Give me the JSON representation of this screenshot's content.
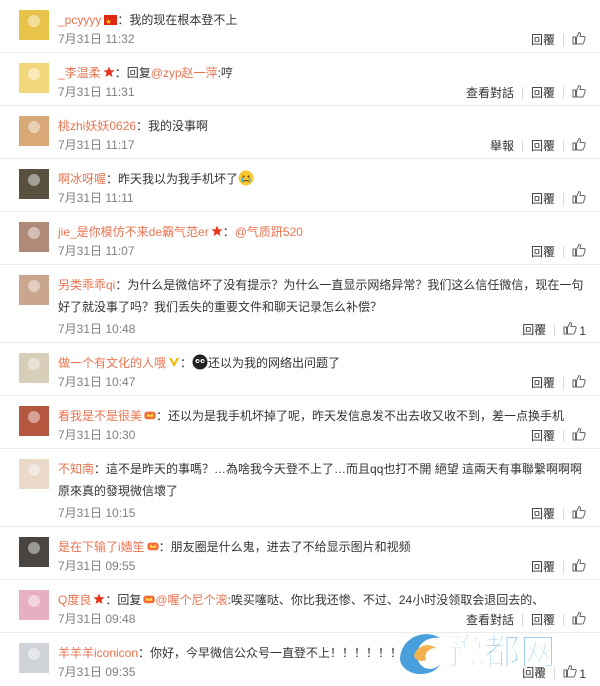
{
  "action_labels": {
    "reply": "回覆",
    "view_conversation": "查看對話",
    "report": "舉報"
  },
  "comments": [
    {
      "user": "_pcyyyy",
      "segments": [
        {
          "t": "：我的现在根本登不上"
        }
      ],
      "time": "7月31日 11:32",
      "likes": ""
    },
    {
      "user": "_李温柔",
      "segments": [
        {
          "t": "：回复"
        },
        {
          "t": "@zyp赵一萍",
          "m": true
        },
        {
          "t": ":哼"
        }
      ],
      "time": "7月31日 11:31",
      "likes": ""
    },
    {
      "user": "桃zhi妖妖0626",
      "segments": [
        {
          "t": "：我的没事啊"
        }
      ],
      "time": "7月31日 11:17",
      "likes": ""
    },
    {
      "user": "啊冰呀喔",
      "segments": [
        {
          "t": "：昨天我以为我手机坏了"
        }
      ],
      "time": "7月31日 11:11",
      "likes": ""
    },
    {
      "user": "jie_是你模仿不来de霸气范er",
      "segments": [
        {
          "t": "："
        },
        {
          "t": "@气质趼520",
          "m": true
        }
      ],
      "time": "7月31日 11:07",
      "likes": ""
    },
    {
      "user": "另类乖乖qi",
      "segments": [
        {
          "t": "：为什么是微信坏了没有提示？为什么一直显示网络异常？我们这么信任微信，现在一句好了就没事了吗？我们丢失的重要文件和聊天记录怎么补偿？"
        }
      ],
      "time": "7月31日 10:48",
      "likes": "1"
    },
    {
      "user": "做一个有文化的人哦",
      "segments": [
        {
          "t": "："
        },
        {
          "t": "还以为我的网络出问题了"
        }
      ],
      "time": "7月31日 10:47",
      "likes": ""
    },
    {
      "user": "看我是不是很美",
      "segments": [
        {
          "t": "：还以为是我手机坏掉了呢，昨天发信息发不出去收又收不到，差一点换手机"
        }
      ],
      "time": "7月31日 10:30",
      "likes": ""
    },
    {
      "user": "不知南",
      "segments": [
        {
          "t": "：這不是昨天的事嗎？…為啥我今天登不上了…而且qq也打不開  絕望  這兩天有事聯繫啊啊啊  原來真的發現微信壞了"
        }
      ],
      "time": "7月31日 10:15",
      "likes": ""
    },
    {
      "user": "是在下输了i嫱笙",
      "segments": [
        {
          "t": "：朋友圈是什么鬼，进去了不给显示图片和视频"
        }
      ],
      "time": "7月31日 09:55",
      "likes": ""
    },
    {
      "user": "Q度良",
      "segments": [
        {
          "t": "：回复"
        },
        {
          "t": "@喔个尼个滚",
          "m": true
        },
        {
          "t": ":唉买噻哒、你比我还惨、不过、24小时没领取会退回去的、"
        }
      ],
      "time": "7月31日 09:48",
      "likes": ""
    },
    {
      "user": "羊羊羊iconicon",
      "segments": [
        {
          "t": "：你好，今早微信公众号一直登不上！！！！！！"
        }
      ],
      "time": "7月31日 09:35",
      "likes": "1"
    }
  ],
  "watermark": {
    "text": "豫都网",
    "color": "#2a8fd6"
  },
  "colors": {
    "username": "#eb7350",
    "divider": "#ebebeb",
    "meta": "#808080"
  }
}
